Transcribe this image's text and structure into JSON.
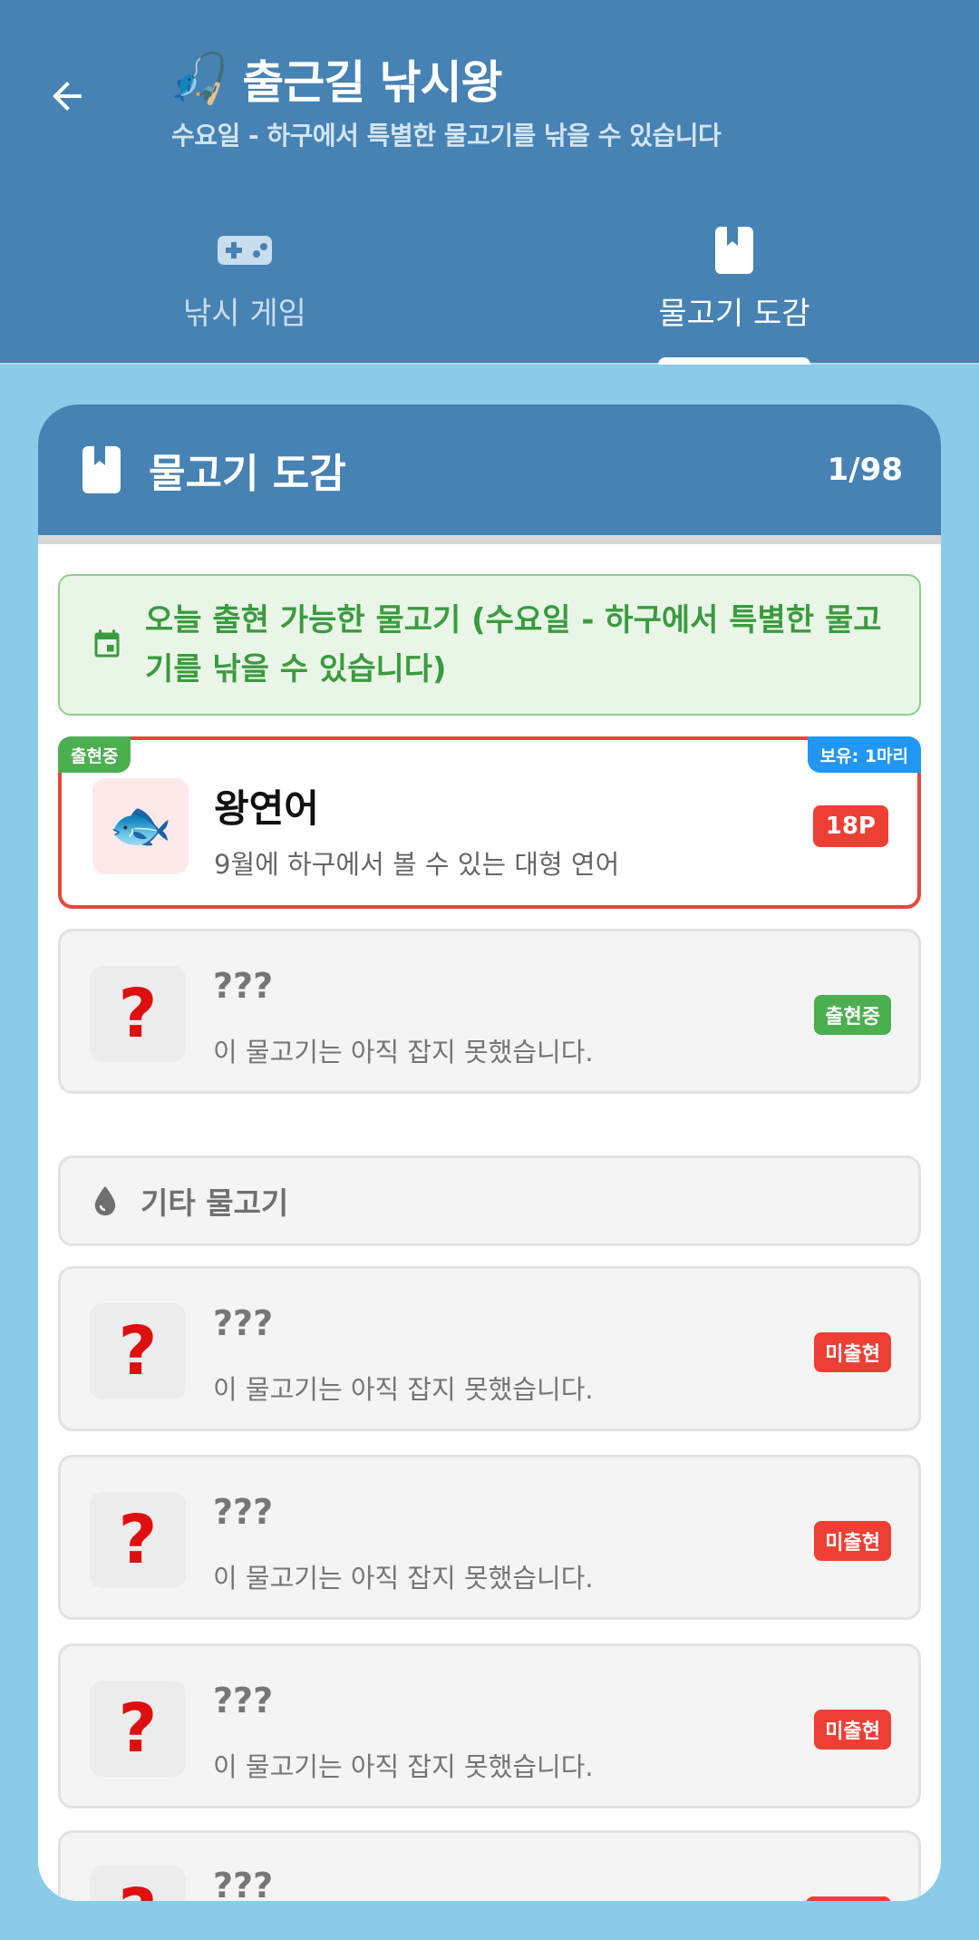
{
  "header": {
    "title": "출근길 낚시왕",
    "title_icon": "🎣",
    "subtitle": "수요일 - 하구에서 특별한 물고기를 낚을 수 있습니다",
    "tabs": [
      {
        "label": "낚시 게임",
        "icon": "gamepad-icon",
        "active": false
      },
      {
        "label": "물고기 도감",
        "icon": "bookmark-icon",
        "active": true
      }
    ]
  },
  "dex": {
    "title": "물고기 도감",
    "count": "1/98",
    "today_banner": "오늘 출현 가능한 물고기 (수요일 - 하구에서 특별한 물고기를 낚을 수 있습니다)",
    "caught_fish": {
      "name": "왕연어",
      "icon": "🐟",
      "description": "9월에 하구에서 볼 수 있는 대형 연어",
      "points": "18P",
      "tag_left": "출현중",
      "tag_right": "보유: 1마리"
    },
    "today_unknown": [
      {
        "name": "???",
        "description": "이 물고기는 아직 잡지 못했습니다.",
        "status": "출현중"
      }
    ],
    "other_section_title": "기타 물고기",
    "other_fish": [
      {
        "name": "???",
        "description": "이 물고기는 아직 잡지 못했습니다.",
        "status": "미출현"
      },
      {
        "name": "???",
        "description": "이 물고기는 아직 잡지 못했습니다.",
        "status": "미출현"
      },
      {
        "name": "???",
        "description": "이 물고기는 아직 잡지 못했습니다.",
        "status": "미출현"
      },
      {
        "name": "???",
        "description": "",
        "status": ""
      }
    ],
    "unknown_symbol": "?"
  },
  "colors": {
    "header": "#4682b4",
    "background": "#8acbe9",
    "available": "#4bae4f",
    "unavailable": "#ee3f35",
    "owned": "#2196f3"
  }
}
